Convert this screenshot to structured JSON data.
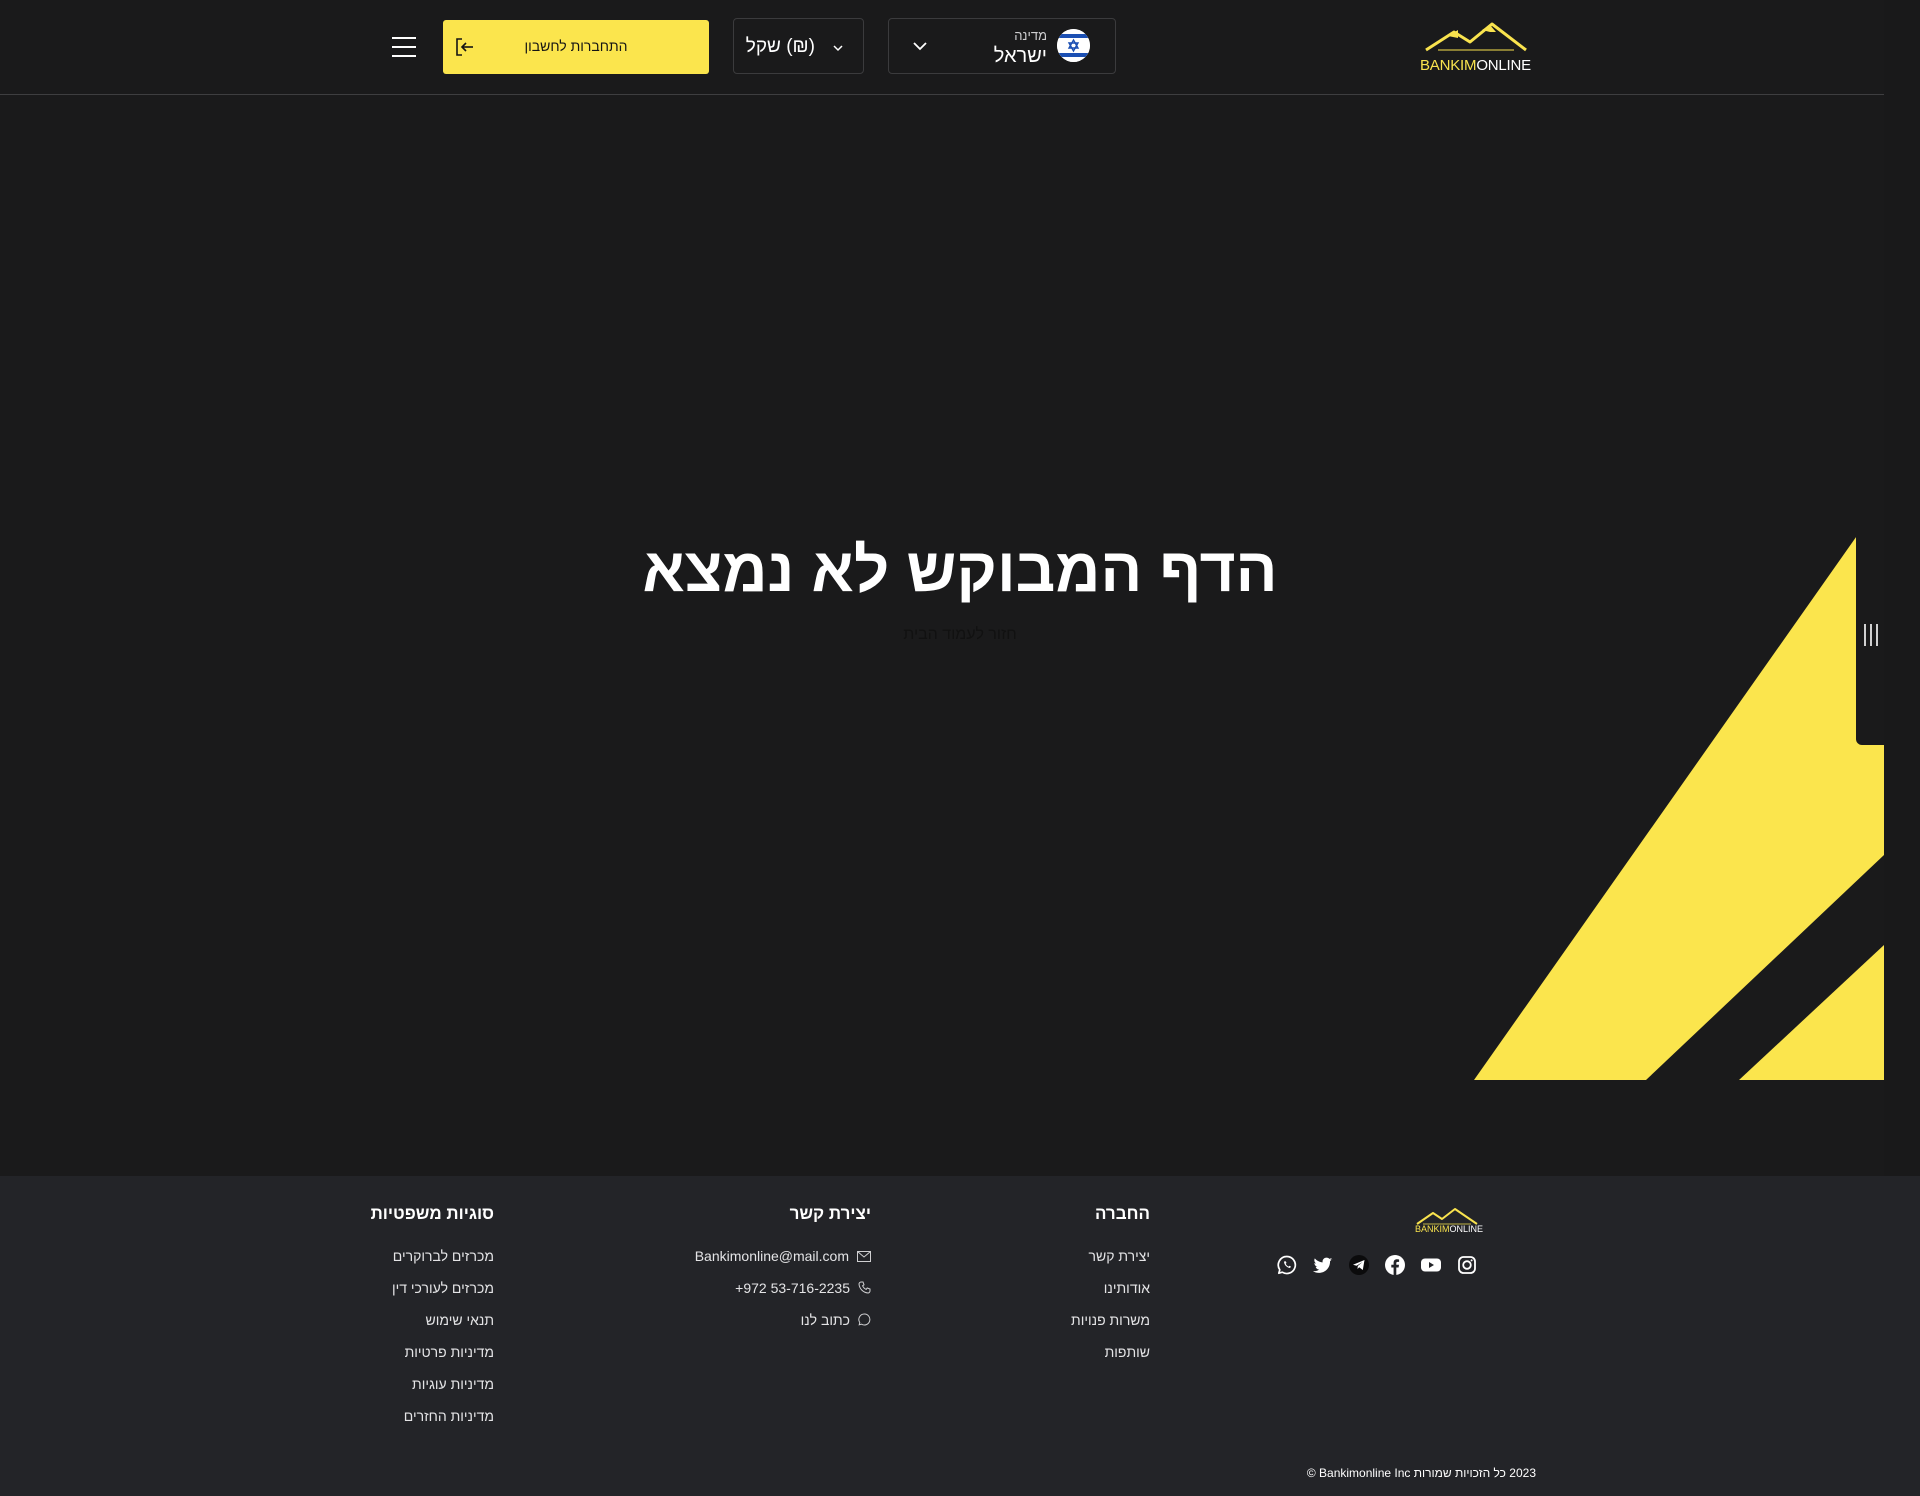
{
  "header": {
    "logo": {
      "part1": "BANKIM",
      "part2": "ONLINE"
    },
    "country": {
      "label": "מדינה",
      "value": "ישראל",
      "flag_icon": "israel-flag-icon"
    },
    "currency": {
      "value": "(₪) שקל"
    },
    "login_button": {
      "label": "התחברות לחשבון",
      "icon": "login-icon"
    },
    "menu_icon": "hamburger-menu-icon"
  },
  "main": {
    "title": "הדף המבוקש לא נמצא",
    "home_link": "חזור לעמוד הבית",
    "side_tab_icon": "vertical-lines-icon"
  },
  "footer": {
    "logo": {
      "part1": "BANKIM",
      "part2": "ONLINE"
    },
    "socials": [
      "instagram-icon",
      "youtube-icon",
      "facebook-icon",
      "telegram-icon",
      "twitter-icon",
      "whatsapp-icon"
    ],
    "company": {
      "title": "החברה",
      "items": [
        "יצירת קשר",
        "אודותינו",
        "משרות פנויות",
        "שותפות"
      ]
    },
    "contact": {
      "title": "יצירת קשר",
      "email": "Bankimonline@mail.com",
      "phone": "+972 53-716-2235",
      "write": "כתוב לנו"
    },
    "legal": {
      "title": "סוגיות משפטיות",
      "items": [
        "מכרזים לברוקרים",
        "מכרזים לעורכי דין",
        "תנאי שימוש",
        "מדיניות פרטיות",
        "מדיניות עוגיות",
        "מדיניות החזרים"
      ]
    },
    "copyright": "2023 כל הזכויות שמורות Bankimonline Inc ©"
  },
  "colors": {
    "accent": "#fbe54d",
    "background": "#1a1a1b",
    "footer_bg": "#232428"
  }
}
